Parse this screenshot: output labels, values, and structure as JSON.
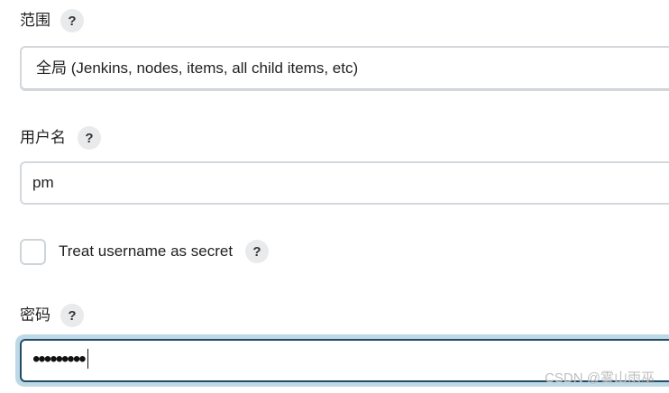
{
  "form": {
    "scope": {
      "label": "范围",
      "help": "?",
      "selected_value": "全局 (Jenkins, nodes, items, all child items, etc)"
    },
    "username": {
      "label": "用户名",
      "help": "?",
      "value": "pm"
    },
    "username_secret": {
      "label": "Treat username as secret",
      "help": "?",
      "checked": false
    },
    "password": {
      "label": "密码",
      "help": "?",
      "masked_value": "•••••••••"
    }
  },
  "watermark": {
    "text": "CSDN @雾山雨巫"
  },
  "colors": {
    "focus_border": "#1f4e66",
    "focus_ring": "#bed8e6",
    "field_border": "#d4d8dc",
    "help_bg": "#e9eaec"
  },
  "icons": {
    "help": "question-mark-circle-icon",
    "checkbox": "checkbox-unchecked"
  }
}
